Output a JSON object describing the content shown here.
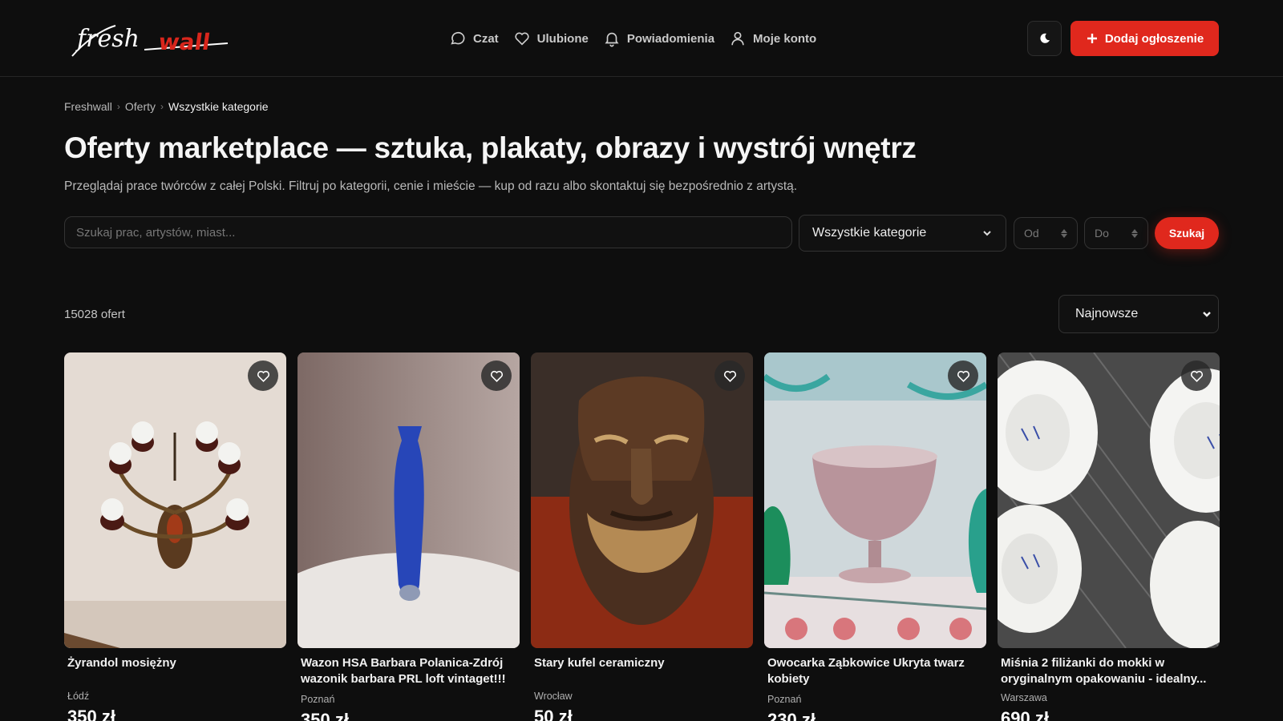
{
  "header": {
    "logo_text": "freshwall",
    "nav": [
      {
        "label": "Czat",
        "icon": "chat-icon"
      },
      {
        "label": "Ulubione",
        "icon": "heart-icon"
      },
      {
        "label": "Powiadomienia",
        "icon": "bell-icon"
      },
      {
        "label": "Moje konto",
        "icon": "user-icon"
      }
    ],
    "theme_icon": "moon-icon",
    "add_button": "Dodaj ogłoszenie",
    "accent": "#e0281d"
  },
  "breadcrumb": [
    "Freshwall",
    "Oferty",
    "Wszystkie kategorie"
  ],
  "page": {
    "title": "Oferty marketplace — sztuka, plakaty, obrazy i wystrój wnętrz",
    "subtitle": "Przeglądaj prace twórców z całej Polski. Filtruj po kategorii, cenie i mieście — kup od razu albo skontaktuj się bezpośrednio z artystą."
  },
  "filters": {
    "search_placeholder": "Szukaj prac, artystów, miast...",
    "category_selected": "Wszystkie kategorie",
    "price_from_placeholder": "Od",
    "price_to_placeholder": "Do",
    "search_button": "Szukaj"
  },
  "results": {
    "count_label": "15028 ofert",
    "sort_selected": "Najnowsze"
  },
  "listings": [
    {
      "title": "Żyrandol mosiężny",
      "city": "Łódź",
      "price": "350 zł"
    },
    {
      "title": "Wazon HSA Barbara Polanica-Zdrój wazonik barbara PRL loft vintaget!!!",
      "city": "Poznań",
      "price": "350 zł"
    },
    {
      "title": "Stary kufel ceramiczny",
      "city": "Wrocław",
      "price": "50 zł"
    },
    {
      "title": "Owocarka Ząbkowice Ukryta twarz kobiety",
      "city": "Poznań",
      "price": "230 zł"
    },
    {
      "title": "Miśnia 2 filiżanki do mokki w oryginalnym opakowaniu - idealny...",
      "city": "Warszawa",
      "price": "690 zł"
    }
  ]
}
